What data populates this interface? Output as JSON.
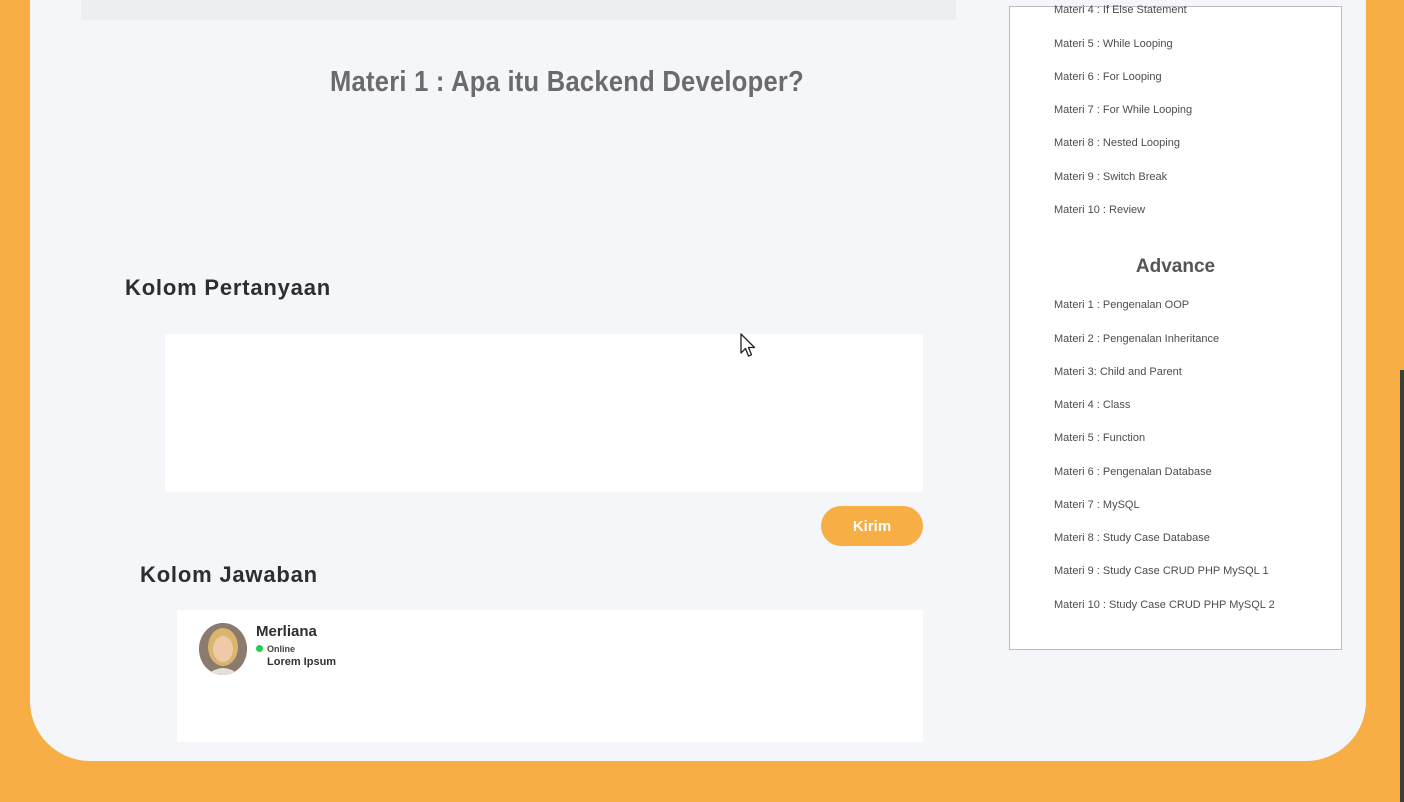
{
  "lesson": {
    "title": "Materi 1 : Apa itu Backend Developer?"
  },
  "question_section": {
    "heading": "Kolom Pertanyaan",
    "input_value": "",
    "send_label": "Kirim"
  },
  "answer_section": {
    "heading": "Kolom Jawaban",
    "answers": [
      {
        "name": "Merliana",
        "status": "Online",
        "text": "Lorem Ipsum"
      }
    ]
  },
  "curriculum": {
    "basic_items": [
      "Materi 4 : If Else Statement",
      "Materi 5 : While Looping",
      "Materi 6 : For Looping",
      "Materi 7 : For While Looping",
      "Materi 8 : Nested Looping",
      "Materi 9 : Switch Break",
      "Materi 10 : Review"
    ],
    "advance_heading": "Advance",
    "advance_items": [
      "Materi 1 : Pengenalan OOP",
      "Materi 2 : Pengenalan Inheritance",
      "Materi 3: Child and Parent",
      "Materi 4 : Class",
      "Materi 5 : Function",
      "Materi 6 : Pengenalan Database",
      "Materi 7 : MySQL",
      "Materi 8 : Study Case Database",
      "Materi 9 : Study Case CRUD PHP MySQL 1",
      "Materi 10 : Study Case CRUD PHP MySQL 2"
    ]
  },
  "colors": {
    "accent": "#f7ae44",
    "online": "#1bd34c",
    "background": "#f4f6fa"
  }
}
